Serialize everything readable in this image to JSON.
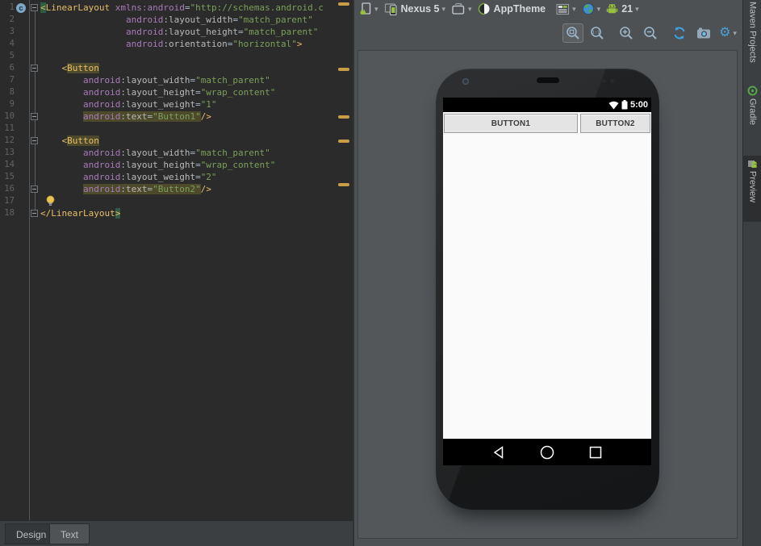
{
  "editor": {
    "tabs": {
      "design": "Design",
      "text": "Text"
    },
    "stripe_marks": [
      3,
      84,
      143,
      173,
      227
    ],
    "lines": [
      {
        "n": 1,
        "fold": "start",
        "icon": "context",
        "tokens": [
          {
            "c": "tag",
            "t": "<",
            "h": "tagmatch"
          },
          {
            "c": "tag",
            "t": "LinearLayout"
          },
          {
            "c": "plain",
            "t": " "
          },
          {
            "c": "ns",
            "t": "xmlns:android"
          },
          {
            "c": "op",
            "t": "="
          },
          {
            "c": "str",
            "t": "\"http://schemas.android.c"
          }
        ]
      },
      {
        "n": 2,
        "tokens": [
          {
            "c": "plain",
            "t": "                "
          },
          {
            "c": "ns",
            "t": "android"
          },
          {
            "c": "op",
            "t": ":"
          },
          {
            "c": "attr",
            "t": "layout_width"
          },
          {
            "c": "op",
            "t": "="
          },
          {
            "c": "str",
            "t": "\"match_parent\""
          }
        ]
      },
      {
        "n": 3,
        "tokens": [
          {
            "c": "plain",
            "t": "                "
          },
          {
            "c": "ns",
            "t": "android"
          },
          {
            "c": "op",
            "t": ":"
          },
          {
            "c": "attr",
            "t": "layout_height"
          },
          {
            "c": "op",
            "t": "="
          },
          {
            "c": "str",
            "t": "\"match_parent\""
          }
        ]
      },
      {
        "n": 4,
        "tokens": [
          {
            "c": "plain",
            "t": "                "
          },
          {
            "c": "ns",
            "t": "android"
          },
          {
            "c": "op",
            "t": ":"
          },
          {
            "c": "attr",
            "t": "orientation"
          },
          {
            "c": "op",
            "t": "="
          },
          {
            "c": "str",
            "t": "\"horizontal\""
          },
          {
            "c": "tag",
            "t": ">"
          }
        ]
      },
      {
        "n": 5,
        "tokens": []
      },
      {
        "n": 6,
        "fold": "start",
        "tokens": [
          {
            "c": "plain",
            "t": "    "
          },
          {
            "c": "tag",
            "t": "<"
          },
          {
            "c": "tag",
            "t": "Button",
            "h": "usage"
          }
        ]
      },
      {
        "n": 7,
        "tokens": [
          {
            "c": "plain",
            "t": "        "
          },
          {
            "c": "ns",
            "t": "android"
          },
          {
            "c": "op",
            "t": ":"
          },
          {
            "c": "attr",
            "t": "layout_width"
          },
          {
            "c": "op",
            "t": "="
          },
          {
            "c": "str",
            "t": "\"match_parent\""
          }
        ]
      },
      {
        "n": 8,
        "tokens": [
          {
            "c": "plain",
            "t": "        "
          },
          {
            "c": "ns",
            "t": "android"
          },
          {
            "c": "op",
            "t": ":"
          },
          {
            "c": "attr",
            "t": "layout_height"
          },
          {
            "c": "op",
            "t": "="
          },
          {
            "c": "str",
            "t": "\"wrap_content\""
          }
        ]
      },
      {
        "n": 9,
        "tokens": [
          {
            "c": "plain",
            "t": "        "
          },
          {
            "c": "ns",
            "t": "android"
          },
          {
            "c": "op",
            "t": ":"
          },
          {
            "c": "attr",
            "t": "layout_weight"
          },
          {
            "c": "op",
            "t": "="
          },
          {
            "c": "str",
            "t": "\"1\""
          }
        ]
      },
      {
        "n": 10,
        "fold": "end",
        "tokens": [
          {
            "c": "plain",
            "t": "        "
          },
          {
            "c": "ns",
            "t": "android",
            "h": "usage"
          },
          {
            "c": "op",
            "t": ":",
            "h": "usage"
          },
          {
            "c": "attr",
            "t": "text",
            "h": "usage"
          },
          {
            "c": "op",
            "t": "=",
            "h": "usage"
          },
          {
            "c": "str",
            "t": "\"Button1\"",
            "h": "usage"
          },
          {
            "c": "tag",
            "t": "/>"
          }
        ]
      },
      {
        "n": 11,
        "tokens": []
      },
      {
        "n": 12,
        "fold": "start",
        "tokens": [
          {
            "c": "plain",
            "t": "    "
          },
          {
            "c": "tag",
            "t": "<"
          },
          {
            "c": "tag",
            "t": "Button",
            "h": "usage"
          }
        ]
      },
      {
        "n": 13,
        "tokens": [
          {
            "c": "plain",
            "t": "        "
          },
          {
            "c": "ns",
            "t": "android"
          },
          {
            "c": "op",
            "t": ":"
          },
          {
            "c": "attr",
            "t": "layout_width"
          },
          {
            "c": "op",
            "t": "="
          },
          {
            "c": "str",
            "t": "\"match_parent\""
          }
        ]
      },
      {
        "n": 14,
        "tokens": [
          {
            "c": "plain",
            "t": "        "
          },
          {
            "c": "ns",
            "t": "android"
          },
          {
            "c": "op",
            "t": ":"
          },
          {
            "c": "attr",
            "t": "layout_height"
          },
          {
            "c": "op",
            "t": "="
          },
          {
            "c": "str",
            "t": "\"wrap_content\""
          }
        ]
      },
      {
        "n": 15,
        "tokens": [
          {
            "c": "plain",
            "t": "        "
          },
          {
            "c": "ns",
            "t": "android"
          },
          {
            "c": "op",
            "t": ":"
          },
          {
            "c": "attr",
            "t": "layout_weight"
          },
          {
            "c": "op",
            "t": "="
          },
          {
            "c": "str",
            "t": "\"2\""
          }
        ]
      },
      {
        "n": 16,
        "fold": "end",
        "tokens": [
          {
            "c": "plain",
            "t": "        "
          },
          {
            "c": "ns",
            "t": "android",
            "h": "usage"
          },
          {
            "c": "op",
            "t": ":",
            "h": "usage"
          },
          {
            "c": "attr",
            "t": "text",
            "h": "usage"
          },
          {
            "c": "op",
            "t": "=",
            "h": "usage"
          },
          {
            "c": "str",
            "t": "\"Button2\"",
            "h": "usage"
          },
          {
            "c": "tag",
            "t": "/>"
          }
        ]
      },
      {
        "n": 17,
        "bulb": true,
        "tokens": []
      },
      {
        "n": 18,
        "fold": "end",
        "tokens": [
          {
            "c": "tag",
            "t": "</LinearLayout"
          },
          {
            "c": "tag",
            "t": ">",
            "h": "tagmatch"
          }
        ]
      }
    ]
  },
  "preview_toolbar": {
    "config_icon": "layout-config-icon",
    "device_selector": {
      "icon": "device-icon",
      "label": "Nexus 5"
    },
    "orientation_icon": "orientation-icon",
    "theme_selector": {
      "icon": "theme-icon",
      "label": "AppTheme"
    },
    "activity_icon": "activity-selector-icon",
    "locale_icon": "locale-globe-icon",
    "api_selector": {
      "icon": "android-robot-icon",
      "label": "21"
    },
    "zoom_icons": [
      "zoom-to-fit",
      "zoom-actual",
      "zoom-in",
      "zoom-out",
      "refresh",
      "screenshot",
      "settings"
    ]
  },
  "right_tabs": [
    "Maven Projects",
    "Gradle",
    "Preview"
  ],
  "phone": {
    "time": "5:00",
    "buttons": [
      "BUTTON1",
      "BUTTON2"
    ],
    "nav_icons": [
      "back-icon",
      "home-icon",
      "recents-icon"
    ],
    "status_icons": [
      "wifi-icon",
      "battery-icon"
    ]
  },
  "colors": {
    "editor_bg": "#2b2b2b",
    "tag": "#e8bf6a",
    "namespace": "#a87bb8",
    "string": "#7ba05b",
    "usage_highlight": "#4d492b",
    "tag_match": "#2e5d43",
    "stripe_warning": "#c79e45",
    "android_green": "#97c03e",
    "accent_blue": "#4aa0d5"
  }
}
